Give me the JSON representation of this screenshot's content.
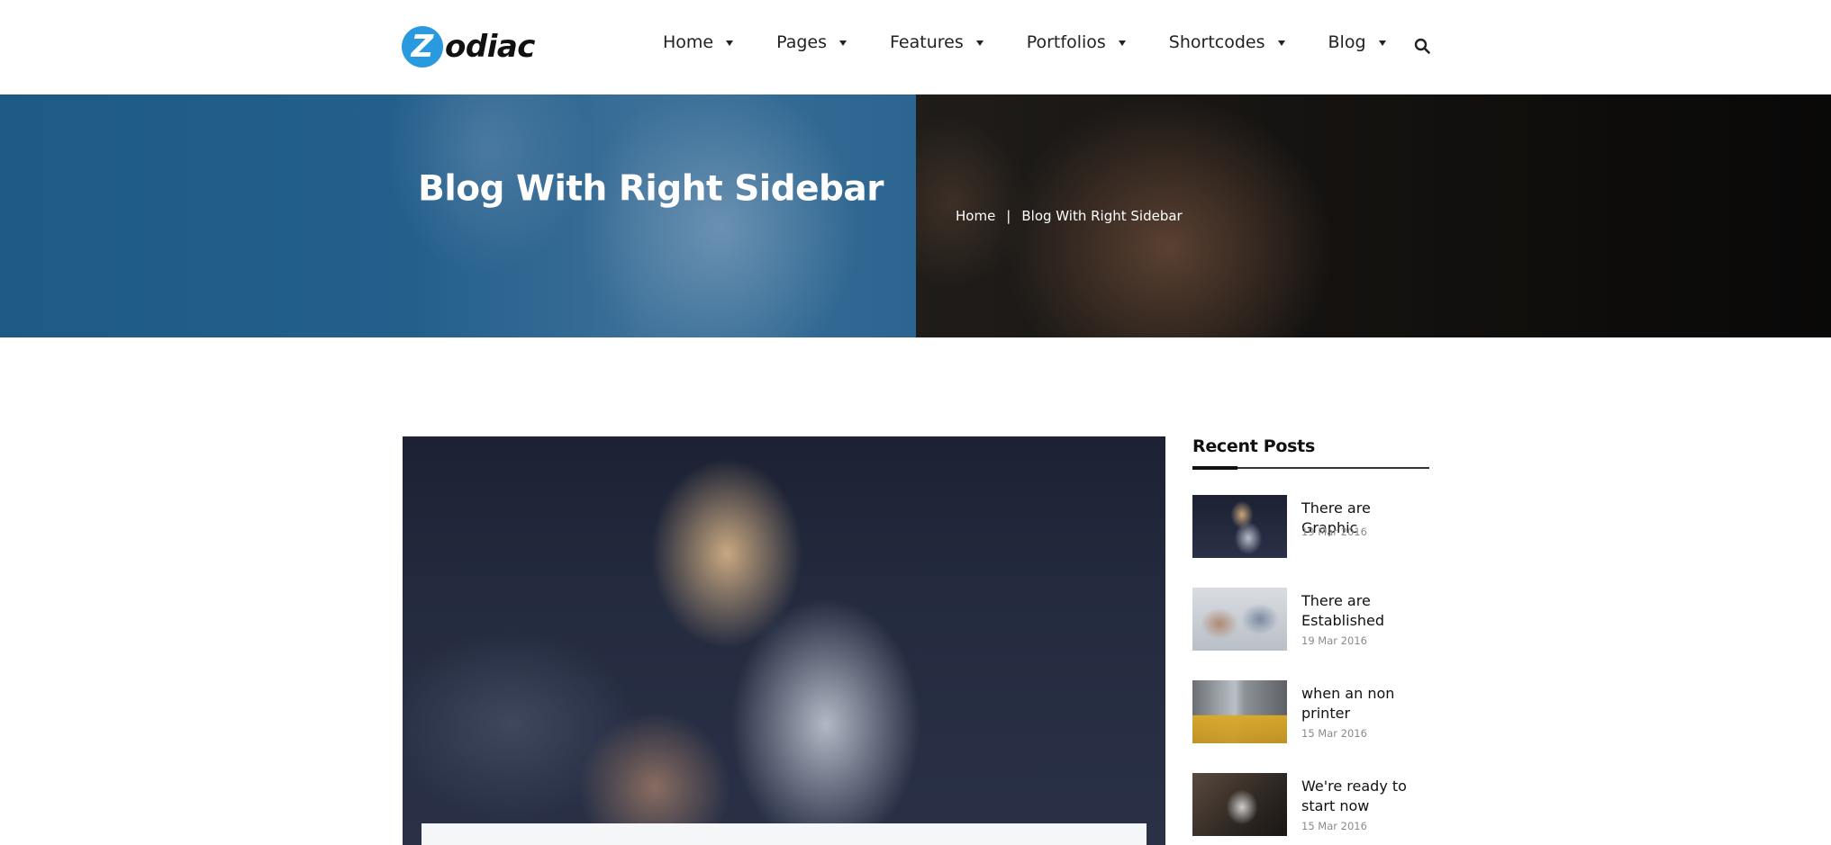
{
  "brand": {
    "logo_letter": "Z",
    "logo_rest": "odiac",
    "accent_color": "#2a9ae0"
  },
  "nav": {
    "items": [
      {
        "label": "Home"
      },
      {
        "label": "Pages"
      },
      {
        "label": "Features"
      },
      {
        "label": "Portfolios"
      },
      {
        "label": "Shortcodes"
      },
      {
        "label": "Blog"
      }
    ],
    "search_icon": "search-icon"
  },
  "banner": {
    "title": "Blog With Right Sidebar",
    "breadcrumb": {
      "home": "Home",
      "separator": "|",
      "current": "Blog With Right Sidebar"
    },
    "left_overlay_color": "#1f5a86"
  },
  "sidebar": {
    "recent_posts": {
      "title": "Recent Posts",
      "items": [
        {
          "title": "There are Graphic",
          "date": "19 Mar 2016"
        },
        {
          "title": "There are Established",
          "date": "19 Mar 2016"
        },
        {
          "title": "when an non printer",
          "date": "15 Mar 2016"
        },
        {
          "title": "We're ready to start now",
          "date": "15 Mar 2016"
        }
      ]
    }
  }
}
